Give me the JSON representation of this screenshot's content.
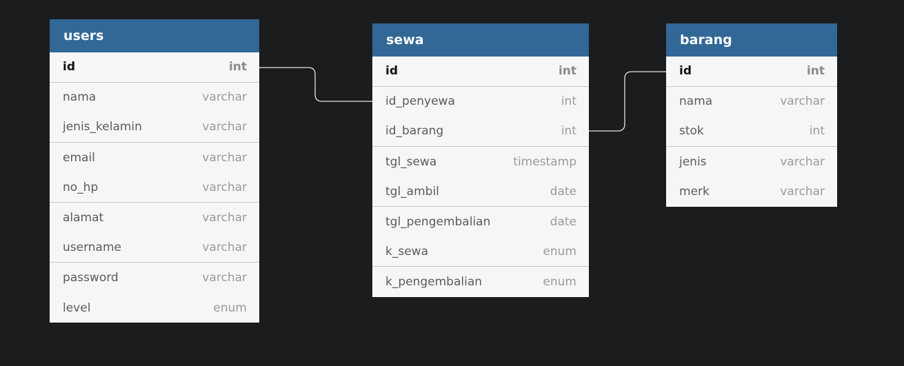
{
  "tables": {
    "users": {
      "name": "users",
      "fields": [
        {
          "name": "id",
          "type": "int",
          "pk": true
        },
        {
          "name": "nama",
          "type": "varchar"
        },
        {
          "name": "jenis_kelamin",
          "type": "varchar"
        },
        {
          "name": "email",
          "type": "varchar"
        },
        {
          "name": "no_hp",
          "type": "varchar"
        },
        {
          "name": "alamat",
          "type": "varchar"
        },
        {
          "name": "username",
          "type": "varchar"
        },
        {
          "name": "password",
          "type": "varchar"
        },
        {
          "name": "level",
          "type": "enum"
        }
      ]
    },
    "sewa": {
      "name": "sewa",
      "fields": [
        {
          "name": "id",
          "type": "int",
          "pk": true
        },
        {
          "name": "id_penyewa",
          "type": "int"
        },
        {
          "name": "id_barang",
          "type": "int"
        },
        {
          "name": "tgl_sewa",
          "type": "timestamp"
        },
        {
          "name": "tgl_ambil",
          "type": "date"
        },
        {
          "name": "tgl_pengembalian",
          "type": "date"
        },
        {
          "name": "k_sewa",
          "type": "enum"
        },
        {
          "name": "k_pengembalian",
          "type": "enum"
        }
      ]
    },
    "barang": {
      "name": "barang",
      "fields": [
        {
          "name": "id",
          "type": "int",
          "pk": true
        },
        {
          "name": "nama",
          "type": "varchar"
        },
        {
          "name": "stok",
          "type": "int"
        },
        {
          "name": "jenis",
          "type": "varchar"
        },
        {
          "name": "merk",
          "type": "varchar"
        }
      ]
    }
  },
  "relations": [
    {
      "from": "users.id",
      "to": "sewa.id_penyewa"
    },
    {
      "from": "barang.id",
      "to": "sewa.id_barang"
    }
  ],
  "colors": {
    "background": "#1b1c1e",
    "header": "#316896",
    "body": "#f6f6f6",
    "connector": "#e6e6e6"
  }
}
